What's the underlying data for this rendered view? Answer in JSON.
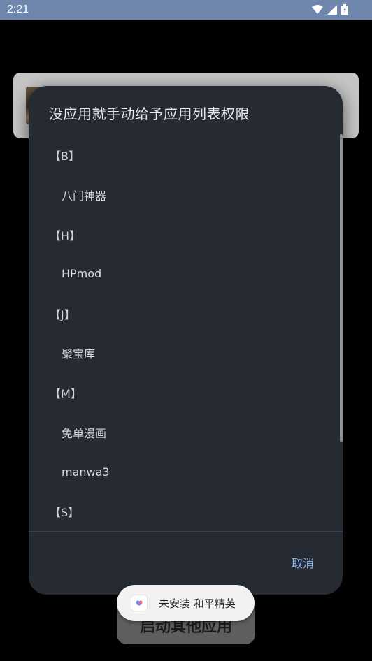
{
  "status_bar": {
    "time": "2:21"
  },
  "dialog": {
    "title": "没应用就手动给予应用列表权限",
    "list": [
      {
        "type": "header",
        "text": "【B】"
      },
      {
        "type": "item",
        "text": "八门神器"
      },
      {
        "type": "header",
        "text": "【H】"
      },
      {
        "type": "item",
        "text": "HPmod"
      },
      {
        "type": "header",
        "text": "【J】"
      },
      {
        "type": "item",
        "text": "聚宝库"
      },
      {
        "type": "header",
        "text": "【M】"
      },
      {
        "type": "item",
        "text": "免单漫画"
      },
      {
        "type": "item",
        "text": "manwa3"
      },
      {
        "type": "header",
        "text": "【S】"
      }
    ],
    "cancel_label": "取消"
  },
  "background_button": {
    "label": "启动其他应用"
  },
  "toast": {
    "text": "未安装 和平精英"
  },
  "colors": {
    "status_bar": "#6f86ad",
    "dialog_bg": "#252a33",
    "accent": "#8ab4e8"
  }
}
